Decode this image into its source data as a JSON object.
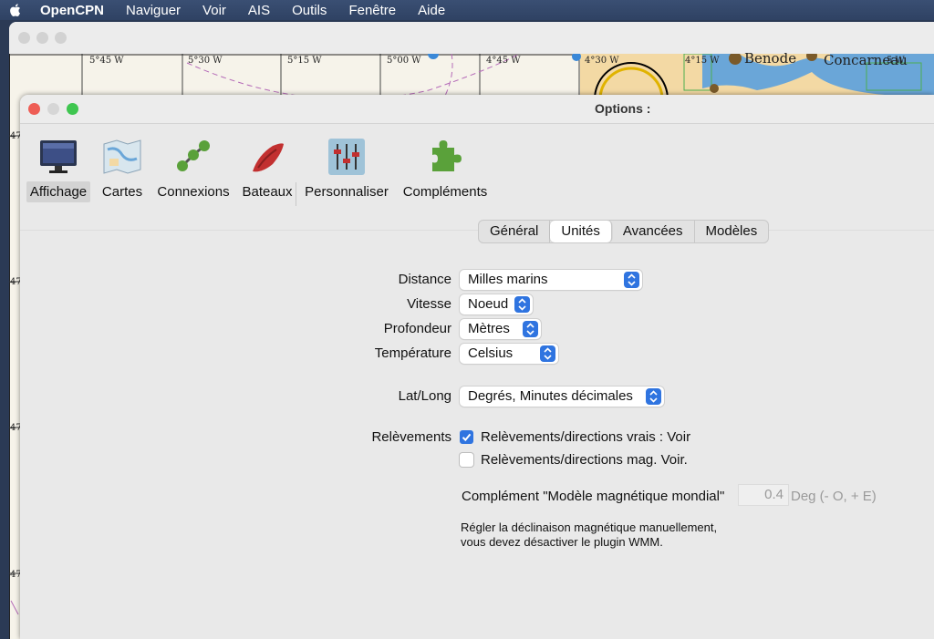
{
  "menubar": {
    "app_name": "OpenCPN",
    "items": [
      "Naviguer",
      "Voir",
      "AIS",
      "Outils",
      "Fenêtre",
      "Aide"
    ]
  },
  "chart": {
    "longitude_labels": [
      "5°45 W",
      "5°30 W",
      "5°15 W",
      "5°00 W",
      "4°45 W",
      "4°30 W",
      "4°15 W",
      "5 W"
    ],
    "place_names": [
      "Benode",
      "Concarneau"
    ],
    "latitude_labels": [
      "47",
      "47",
      "47",
      "47"
    ]
  },
  "options": {
    "title": "Options :",
    "toolbar": {
      "affichage": "Affichage",
      "cartes": "Cartes",
      "connexions": "Connexions",
      "bateaux": "Bateaux",
      "personnaliser": "Personnaliser",
      "complements": "Compléments"
    },
    "tabs": {
      "general": "Général",
      "unites": "Unités",
      "avancees": "Avancées",
      "modeles": "Modèles"
    },
    "fields": {
      "distance_label": "Distance",
      "distance_value": "Milles marins",
      "vitesse_label": "Vitesse",
      "vitesse_value": "Noeud",
      "profondeur_label": "Profondeur",
      "profondeur_value": "Mètres",
      "temperature_label": "Température",
      "temperature_value": "Celsius",
      "latlong_label": "Lat/Long",
      "latlong_value": "Degrés, Minutes décimales",
      "relevements_label": "Relèvements",
      "true_bearings_label": "Relèvements/directions vrais : Voir",
      "true_bearings_checked": true,
      "mag_bearings_label": "Relèvements/directions mag. Voir.",
      "mag_bearings_checked": false,
      "wmm_label": "Complément \"Modèle magnétique mondial\"",
      "wmm_value": "0.4",
      "wmm_unit": "Deg (- O, + E)",
      "note_line1": "Régler la déclinaison magnétique manuellement,",
      "note_line2": "vous devez désactiver le plugin WMM."
    }
  },
  "colors": {
    "accent": "#2f74e0",
    "menubar": "#344869"
  }
}
